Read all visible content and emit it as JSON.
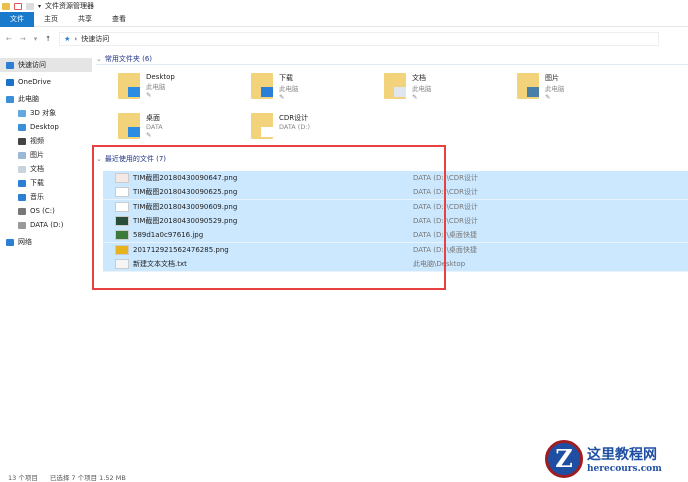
{
  "window": {
    "title": "文件资源管理器"
  },
  "ribbon": {
    "tabs": [
      "文件",
      "主页",
      "共享",
      "查看"
    ]
  },
  "address": {
    "path": "快速访问"
  },
  "sidebar": {
    "items": [
      {
        "label": "快速访问",
        "icon": "star-icon",
        "color": "#2d7fd3",
        "indent": 0
      },
      {
        "label": "OneDrive",
        "icon": "cloud-icon",
        "color": "#1a73c9",
        "indent": 0
      },
      {
        "label": "此电脑",
        "icon": "computer-icon",
        "color": "#3b8fd8",
        "indent": 0
      },
      {
        "label": "3D 对象",
        "icon": "cube-folder-icon",
        "color": "#65a7e0",
        "indent": 1
      },
      {
        "label": "Desktop",
        "icon": "desktop-folder-icon",
        "color": "#3b8fd8",
        "indent": 1
      },
      {
        "label": "视频",
        "icon": "video-folder-icon",
        "color": "#444",
        "indent": 1
      },
      {
        "label": "图片",
        "icon": "pictures-folder-icon",
        "color": "#9bb9d6",
        "indent": 1
      },
      {
        "label": "文档",
        "icon": "documents-folder-icon",
        "color": "#c8d3de",
        "indent": 1
      },
      {
        "label": "下载",
        "icon": "downloads-folder-icon",
        "color": "#2d7fd3",
        "indent": 1
      },
      {
        "label": "音乐",
        "icon": "music-folder-icon",
        "color": "#2d7fd3",
        "indent": 1
      },
      {
        "label": "OS (C:)",
        "icon": "drive-icon",
        "color": "#777",
        "indent": 1
      },
      {
        "label": "DATA (D:)",
        "icon": "drive-icon",
        "color": "#999",
        "indent": 1
      },
      {
        "label": "网络",
        "icon": "network-icon",
        "color": "#2d7fd3",
        "indent": 0
      }
    ]
  },
  "frequent": {
    "header": "常用文件夹 (6)",
    "items": [
      {
        "name": "Desktop",
        "sub": "此电脑",
        "pinned": true,
        "accent": "#2b8ce0"
      },
      {
        "name": "下载",
        "sub": "此电脑",
        "pinned": true,
        "accent": "#2b7fd6"
      },
      {
        "name": "文档",
        "sub": "此电脑",
        "pinned": true,
        "accent": "#dfe6ee"
      },
      {
        "name": "图片",
        "sub": "此电脑",
        "pinned": true,
        "accent": "#4a7fa8"
      },
      {
        "name": "桌面",
        "sub": "DATA",
        "pinned": true,
        "accent": "#2b8ce0"
      },
      {
        "name": "CDR设计",
        "sub": "DATA (D:)",
        "pinned": false,
        "accent": "#ffffff"
      }
    ]
  },
  "recent": {
    "header": "最近使用的文件 (7)",
    "items": [
      {
        "name": "TIM截图20180430090647.png",
        "location": "DATA (D:)\\CDR设计",
        "thumb": "#f4e9e4"
      },
      {
        "name": "TIM截图20180430090625.png",
        "location": "DATA (D:)\\CDR设计",
        "thumb": "#ffffff"
      },
      {
        "name": "TIM截图20180430090609.png",
        "location": "DATA (D:)\\CDR设计",
        "thumb": "#ffffff"
      },
      {
        "name": "TIM截图20180430090529.png",
        "location": "DATA (D:)\\CDR设计",
        "thumb": "#2a4d3a"
      },
      {
        "name": "589d1a0c97616.jpg",
        "location": "DATA (D:)\\桌面快捷",
        "thumb": "#3b7a3a"
      },
      {
        "name": "201712921562476285.png",
        "location": "DATA (D:)\\桌面快捷",
        "thumb": "#e8b21f"
      },
      {
        "name": "新建文本文档.txt",
        "location": "此电脑\\Desktop",
        "thumb": "#f5f5f5"
      }
    ]
  },
  "status": {
    "count": "13 个项目",
    "selected": "已选择 7 个项目  1.52 MB"
  },
  "watermark": {
    "title": "这里教程网",
    "url": "herecours.com"
  }
}
